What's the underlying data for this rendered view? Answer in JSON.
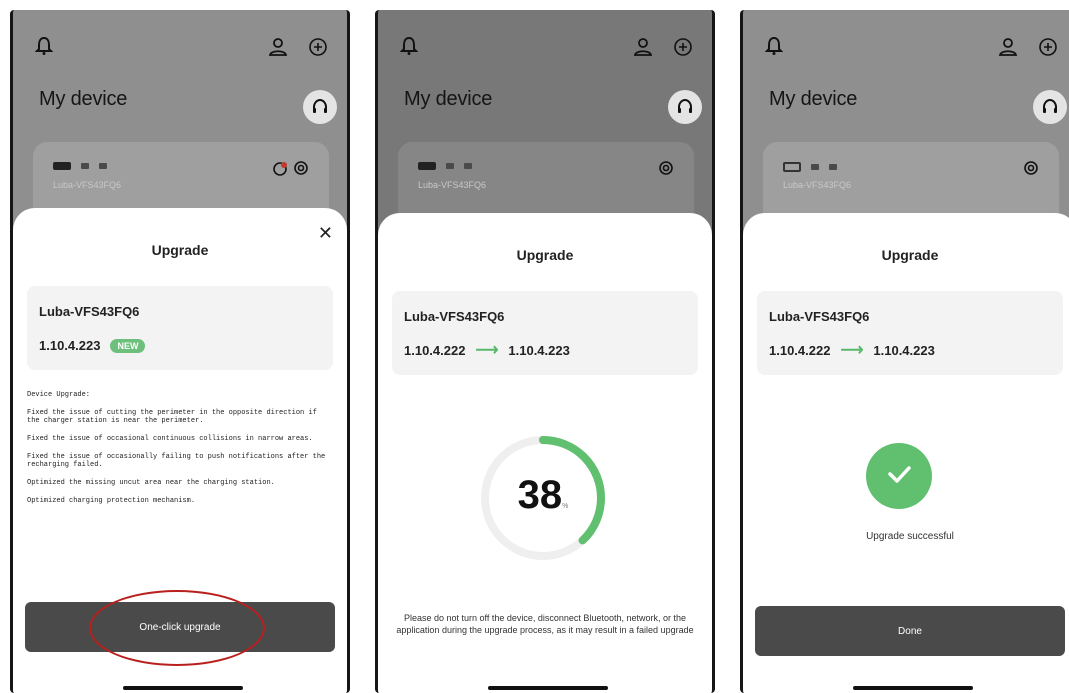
{
  "colors": {
    "accent_green": "#61bf70",
    "button_dark": "#4a4a4a",
    "annotation_red": "#b8201e"
  },
  "icons": [
    "bell-icon",
    "user-icon",
    "plus-circle-icon",
    "headset-icon",
    "gear-icon",
    "alert-icon",
    "close-icon",
    "check-icon",
    "battery-icon"
  ],
  "screens": [
    {
      "header_title": "My device",
      "device_card_name": "Luba-VFS43FQ6",
      "sheet_title": "Upgrade",
      "device_name": "Luba-VFS43FQ6",
      "version": "1.10.4.223",
      "badge": "NEW",
      "notes": [
        "Device Upgrade:",
        "Fixed the issue of cutting the perimeter in the opposite direction if the charger station is near the perimeter.",
        "Fixed the issue of occasional continuous collisions in narrow areas.",
        "Fixed the issue of occasionally failing to push notifications after the recharging failed.",
        "Optimized the missing uncut area near the charging station.",
        "Optimized charging protection mechanism."
      ],
      "button_label": "One-click upgrade"
    },
    {
      "header_title": "My device",
      "device_card_name": "Luba-VFS43FQ6",
      "sheet_title": "Upgrade",
      "device_name": "Luba-VFS43FQ6",
      "version_from": "1.10.4.222",
      "version_to": "1.10.4.223",
      "progress": 38,
      "progress_unit": "%",
      "warning": "Please do not turn off the device, disconnect Bluetooth, network, or the application during the upgrade process, as it may result in a failed upgrade"
    },
    {
      "header_title": "My device",
      "device_card_name": "Luba-VFS43FQ6",
      "sheet_title": "Upgrade",
      "device_name": "Luba-VFS43FQ6",
      "version_from": "1.10.4.222",
      "version_to": "1.10.4.223",
      "status_text": "Upgrade successful",
      "button_label": "Done"
    }
  ]
}
